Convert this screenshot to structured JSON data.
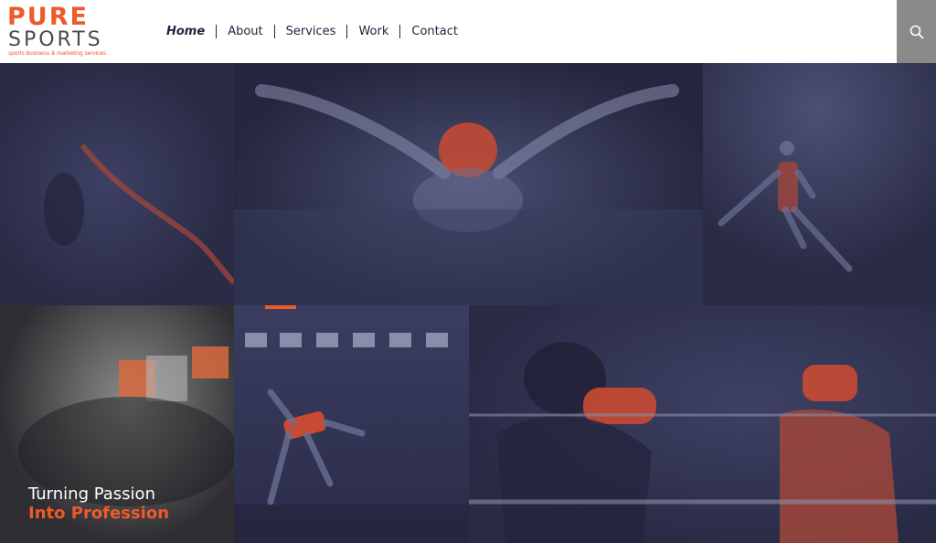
{
  "brand": {
    "name_top": "PURE",
    "name_bottom": "SPORTS",
    "tagline": "sports business & marketing services",
    "accent_color": "#ee5a2a"
  },
  "nav": {
    "items": [
      {
        "label": "Home",
        "active": true
      },
      {
        "label": "About"
      },
      {
        "label": "Services"
      },
      {
        "label": "Work"
      },
      {
        "label": "Contact"
      }
    ]
  },
  "search": {
    "icon": "search-icon"
  },
  "hero": {
    "line1": "Turning Passion",
    "line2": "Into Profession"
  },
  "tiles": [
    {
      "name": "crossfit-rope-photo"
    },
    {
      "name": "swimmer-butterfly-photo"
    },
    {
      "name": "basketball-player-photo"
    },
    {
      "name": "arena-stadium-photo"
    },
    {
      "name": "sprinter-start-photo"
    },
    {
      "name": "boxing-match-photo"
    }
  ]
}
